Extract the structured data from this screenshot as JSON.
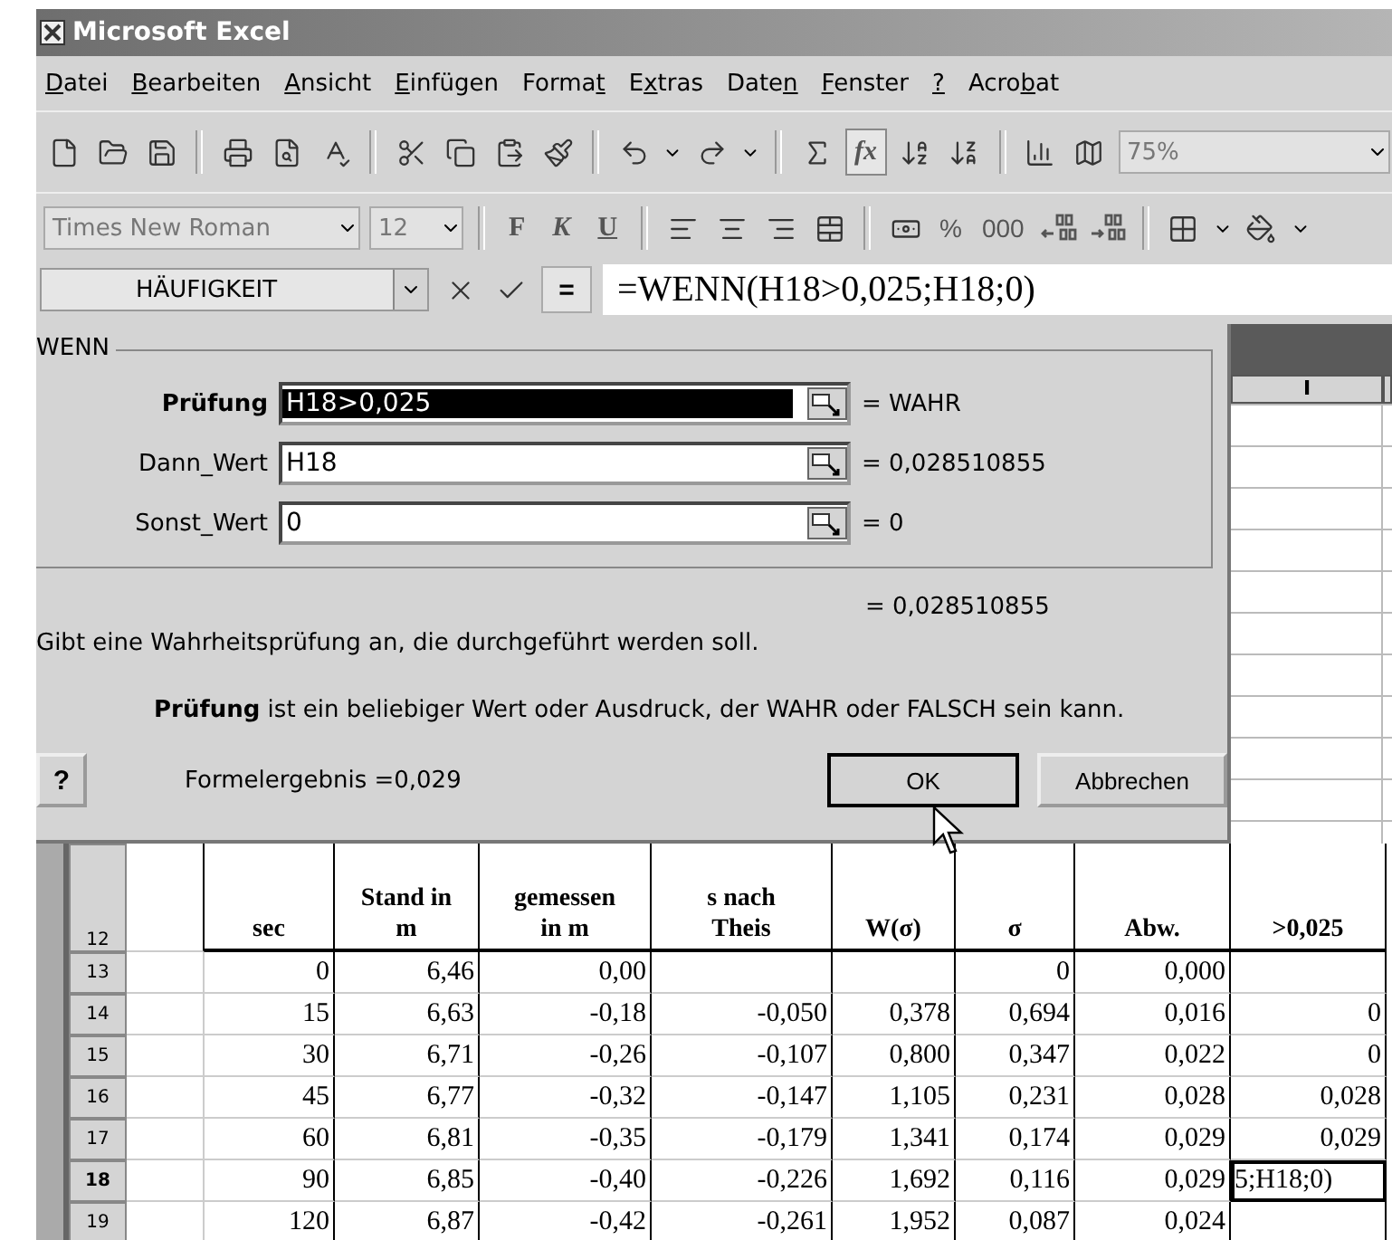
{
  "window": {
    "title": "Microsoft Excel"
  },
  "menu": [
    {
      "access_key": "D",
      "after": "atei"
    },
    {
      "access_key": "B",
      "after": "earbeiten"
    },
    {
      "access_key": "A",
      "after": "nsicht"
    },
    {
      "access_key": "E",
      "after": "infügen"
    },
    {
      "before": "Forma",
      "access_key": "t"
    },
    {
      "before": "E",
      "access_key": "x",
      "after": "tras"
    },
    {
      "before": "Date",
      "access_key": "n"
    },
    {
      "access_key": "F",
      "after": "enster"
    },
    {
      "access_key": "?"
    },
    {
      "before": "Acro",
      "access_key": "b",
      "after": "at"
    }
  ],
  "standard_toolbar": {
    "function_button": {
      "label": "fx",
      "pressed": true
    },
    "zoom": "75%"
  },
  "formatting_toolbar": {
    "font": "Times New Roman",
    "size": "12",
    "style_buttons": [
      {
        "label": "F",
        "kind": "bold"
      },
      {
        "label": "K",
        "kind": "italic"
      },
      {
        "label": "U",
        "kind": "underline"
      }
    ],
    "number_buttons": [
      "%",
      "000"
    ]
  },
  "formula_bar": {
    "name_box": "HÄUFIGKEIT",
    "equals_button": "=",
    "formula": "=WENN(H18>0,025;H18;0)"
  },
  "dialog": {
    "function": "WENN",
    "arguments": [
      {
        "name": "Prüfung",
        "value": "H18>0,025",
        "result": "= WAHR",
        "selected": true
      },
      {
        "name": "Dann_Wert",
        "value": "H18",
        "result": "= 0,028510855",
        "selected": false
      },
      {
        "name": "Sonst_Wert",
        "value": "0",
        "result": "= 0",
        "selected": false
      }
    ],
    "total": "= 0,028510855",
    "description": "Gibt eine Wahrheitsprüfung an, die durchgeführt werden soll.",
    "argument_help": "**Prüfung** ist ein beliebiger Wert oder Ausdruck, der WAHR oder FALSCH sein kann.",
    "help_button": "?",
    "formula_result": "Formelergebnis =0,029",
    "buttons": [
      {
        "label": "OK",
        "default": true
      },
      {
        "label": "Abbrechen",
        "default": false
      }
    ]
  },
  "sheet": {
    "visible_column": "I",
    "header_row": {
      "number": "12",
      "cells": [
        null,
        [
          "sec"
        ],
        [
          "Stand in",
          "m"
        ],
        [
          "gemessen",
          "in m"
        ],
        [
          "s  nach",
          "Theis"
        ],
        [
          "W(σ)"
        ],
        [
          "σ"
        ],
        [
          "Abw."
        ],
        [
          ">0,025"
        ]
      ]
    },
    "rows": [
      {
        "number": "13",
        "selected": false,
        "cells": [
          null,
          "0",
          "6,46",
          "0,00",
          null,
          null,
          "0",
          "0,000",
          null
        ]
      },
      {
        "number": "14",
        "selected": false,
        "cells": [
          null,
          "15",
          "6,63",
          "-0,18",
          "-0,050",
          "0,378",
          "0,694",
          "0,016",
          "0"
        ]
      },
      {
        "number": "15",
        "selected": false,
        "cells": [
          null,
          "30",
          "6,71",
          "-0,26",
          "-0,107",
          "0,800",
          "0,347",
          "0,022",
          "0"
        ]
      },
      {
        "number": "16",
        "selected": false,
        "cells": [
          null,
          "45",
          "6,77",
          "-0,32",
          "-0,147",
          "1,105",
          "0,231",
          "0,028",
          "0,028"
        ]
      },
      {
        "number": "17",
        "selected": false,
        "cells": [
          null,
          "60",
          "6,81",
          "-0,35",
          "-0,179",
          "1,341",
          "0,174",
          "0,029",
          "0,029"
        ]
      },
      {
        "number": "18",
        "selected": true,
        "cells": [
          null,
          "90",
          "6,85",
          "-0,40",
          "-0,226",
          "1,692",
          "0,116",
          "0,029",
          "5;H18;0)"
        ]
      },
      {
        "number": "19",
        "selected": false,
        "cells": [
          null,
          "120",
          "6,87",
          "-0,42",
          "-0,261",
          "1,952",
          "0,087",
          "0,024",
          null
        ]
      }
    ]
  }
}
